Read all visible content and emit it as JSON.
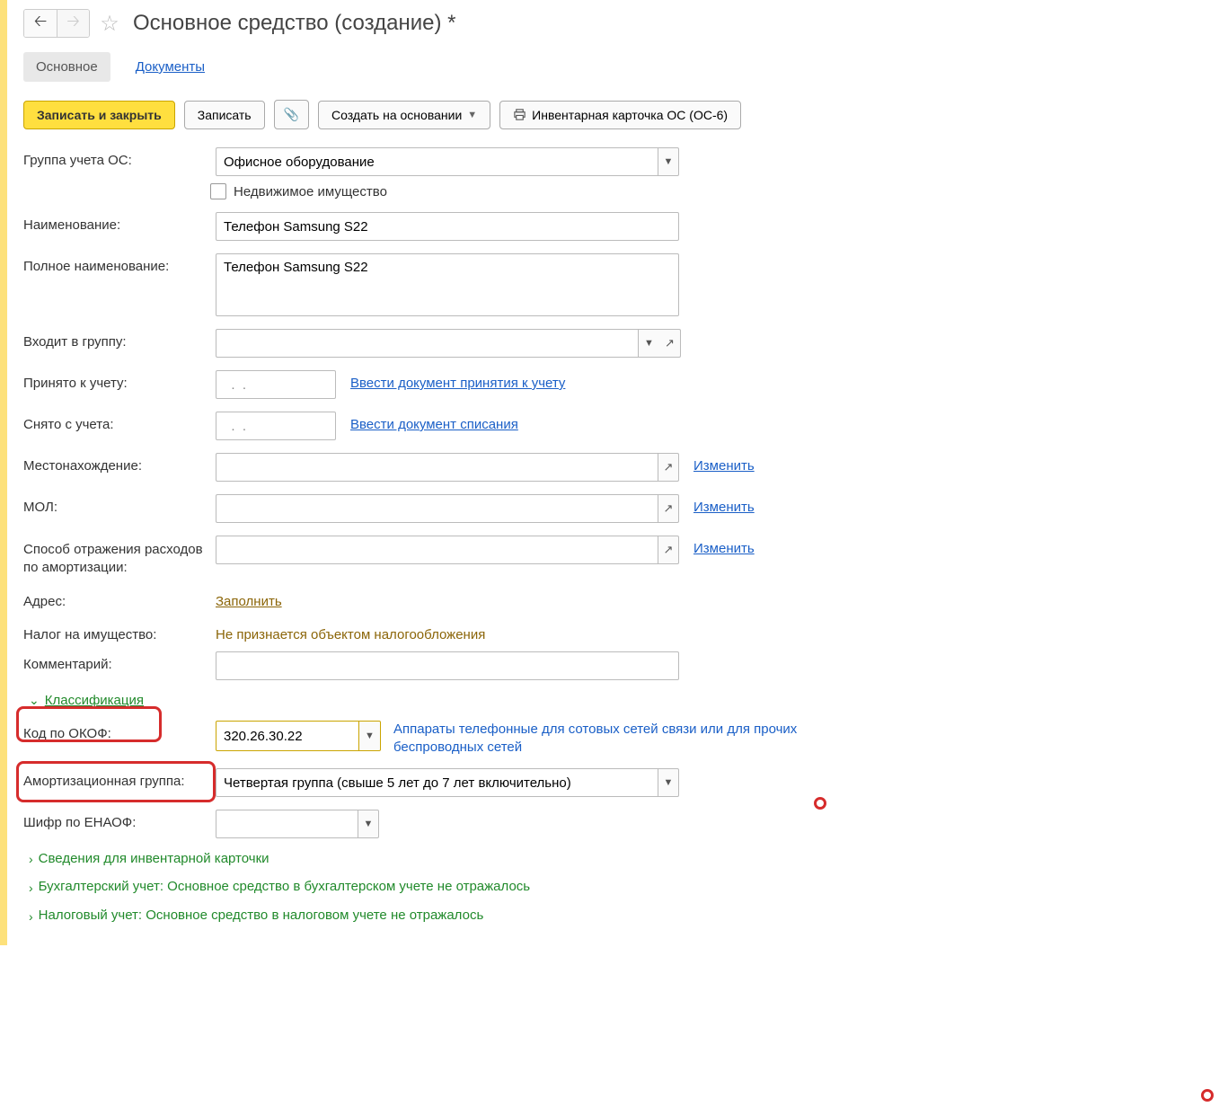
{
  "header": {
    "title": "Основное средство (создание) *"
  },
  "tabs": {
    "main": "Основное",
    "docs": "Документы"
  },
  "toolbar": {
    "save_close": "Записать и закрыть",
    "save": "Записать",
    "create_based": "Создать на основании",
    "inventory_card": "Инвентарная карточка ОС (ОС-6)"
  },
  "fields": {
    "group_label": "Группа учета ОС:",
    "group_value": "Офисное оборудование",
    "immovable_label": "Недвижимое имущество",
    "name_label": "Наименование:",
    "name_value": "Телефон Samsung S22",
    "fullname_label": "Полное наименование:",
    "fullname_value": "Телефон Samsung S22",
    "ingroup_label": "Входит в группу:",
    "ingroup_value": "",
    "accepted_label": "Принято к учету:",
    "accepted_value": "  .  .",
    "accepted_link": "Ввести документ принятия к учету",
    "removed_label": "Снято с учета:",
    "removed_value": "  .  .",
    "removed_link": "Ввести документ списания",
    "location_label": "Местонахождение:",
    "location_value": "",
    "change_link": "Изменить",
    "mol_label": "МОЛ:",
    "mol_value": "",
    "expense_label": "Способ отражения расходов по амортизации:",
    "expense_value": "",
    "address_label": "Адрес:",
    "fill_link": "Заполнить",
    "tax_label": "Налог на имущество:",
    "tax_value": "Не признается объектом налогообложения",
    "comment_label": "Комментарий:",
    "comment_value": ""
  },
  "classification": {
    "header": "Классификация",
    "okof_label": "Код по ОКОФ:",
    "okof_value": "320.26.30.22",
    "okof_desc": "Аппараты телефонные для сотовых сетей связи или для прочих беспроводных сетей",
    "amort_label": "Амортизационная группа:",
    "amort_value": "Четвертая группа (свыше 5 лет до 7 лет включительно)",
    "enaof_label": "Шифр по ЕНАОФ:",
    "enaof_value": ""
  },
  "sections": {
    "inventory": "Сведения для инвентарной карточки",
    "bu": "Бухгалтерский учет: Основное средство в бухгалтерском учете не отражалось",
    "nu": "Налоговый учет: Основное средство в налоговом учете не отражалось"
  }
}
